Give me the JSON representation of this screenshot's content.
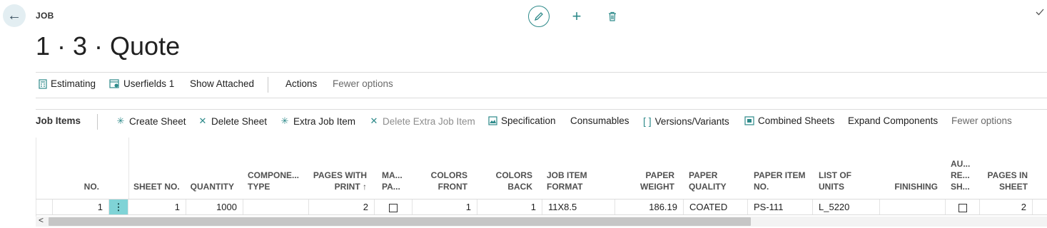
{
  "header": {
    "caption": "JOB",
    "title": "1 · 3 · Quote"
  },
  "toolbar1": {
    "estimating": "Estimating",
    "userfields": "Userfields 1",
    "show_attached": "Show Attached",
    "actions": "Actions",
    "fewer_options": "Fewer options"
  },
  "toolbar2": {
    "title": "Job Items",
    "create_sheet": "Create Sheet",
    "delete_sheet": "Delete Sheet",
    "extra_job_item": "Extra Job Item",
    "delete_extra_job_item": "Delete Extra Job Item",
    "specification": "Specification",
    "consumables": "Consumables",
    "versions_variants": "Versions/Variants",
    "combined_sheets": "Combined Sheets",
    "expand_components": "Expand Components",
    "fewer_options": "Fewer options"
  },
  "grid": {
    "headers": {
      "no": "NO.",
      "sheet_no": "SHEET NO.",
      "quantity": "QUANTITY",
      "component_type_1": "COMPONE...",
      "component_type_2": "TYPE",
      "pages_with_print_1": "PAGES WITH",
      "pages_with_print_2": "PRINT ↑",
      "ma_pa_1": "MA...",
      "ma_pa_2": "PA...",
      "colors_front_1": "COLORS",
      "colors_front_2": "FRONT",
      "colors_back_1": "COLORS",
      "colors_back_2": "BACK",
      "job_item_format_1": "JOB ITEM",
      "job_item_format_2": "FORMAT",
      "paper_weight_1": "PAPER",
      "paper_weight_2": "WEIGHT",
      "paper_quality_1": "PAPER",
      "paper_quality_2": "QUALITY",
      "paper_item_no_1": "PAPER ITEM",
      "paper_item_no_2": "NO.",
      "list_of_units_1": "LIST OF",
      "list_of_units_2": "UNITS",
      "finishing": "FINISHING",
      "au_re_sh_1": "AU...",
      "au_re_sh_2": "RE...",
      "au_re_sh_3": "SH...",
      "pages_in_sheet_1": "PAGES IN",
      "pages_in_sheet_2": "SHEET"
    },
    "row": {
      "no": "1",
      "sheet_no": "1",
      "quantity": "1000",
      "component_type": "",
      "pages_with_print": "2",
      "colors_front": "1",
      "colors_back": "1",
      "job_item_format": "11X8.5",
      "paper_weight": "186.19",
      "paper_quality": "COATED",
      "paper_item_no": "PS-111",
      "list_of_units": "L_5220",
      "finishing": "",
      "pages_in_sheet": "2"
    }
  },
  "colors": {
    "accent": "#2e8a8a",
    "row_menu": "#7fd3d6"
  }
}
